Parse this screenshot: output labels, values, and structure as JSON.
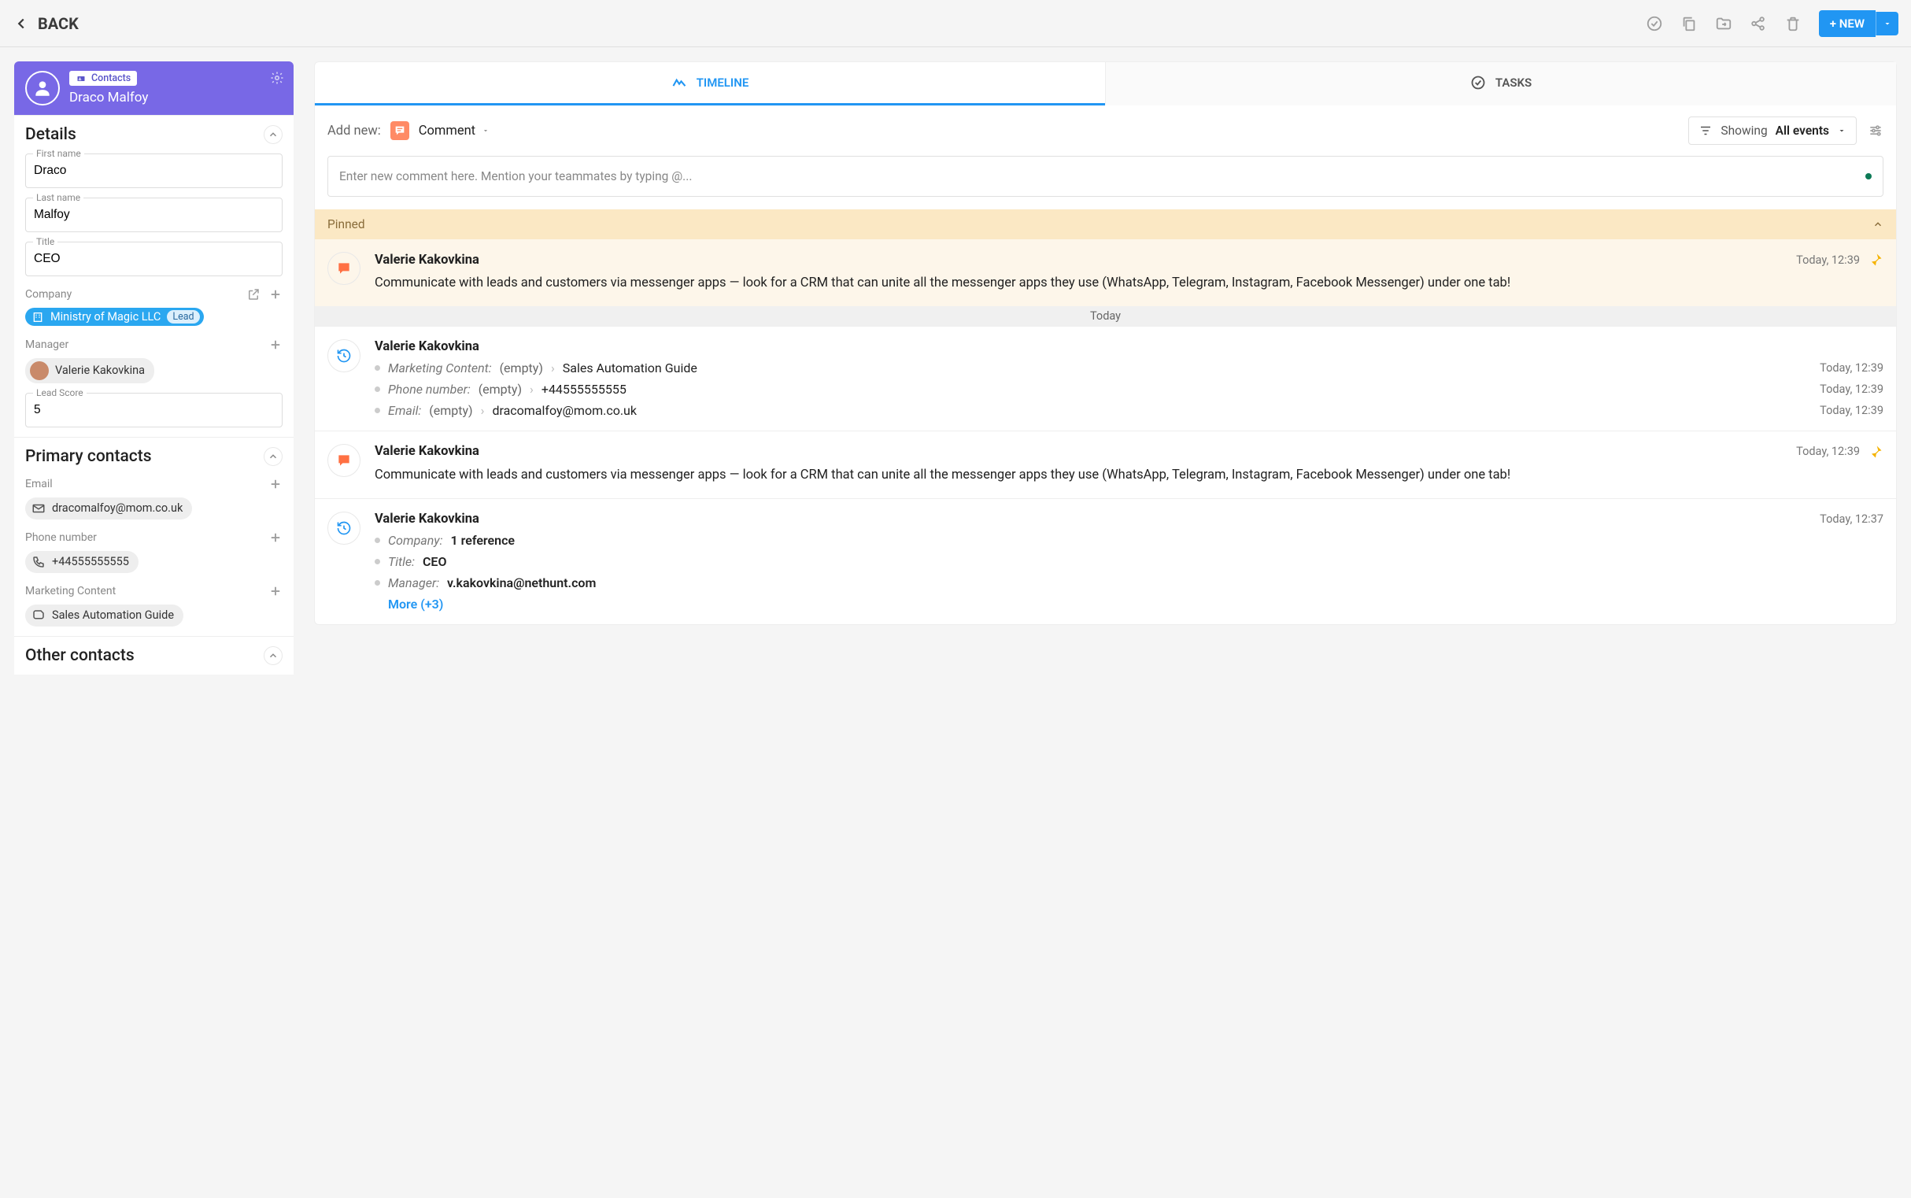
{
  "topbar": {
    "back": "BACK",
    "new_label": "+ NEW"
  },
  "contact": {
    "folder": "Contacts",
    "name": "Draco Malfoy"
  },
  "sections": {
    "details": "Details",
    "primary": "Primary contacts",
    "other": "Other contacts"
  },
  "details": {
    "first_name_label": "First name",
    "first_name": "Draco",
    "last_name_label": "Last name",
    "last_name": "Malfoy",
    "title_label": "Title",
    "title": "CEO",
    "company_label": "Company",
    "company_name": "Ministry of Magic LLC",
    "company_stage": "Lead",
    "manager_label": "Manager",
    "manager_name": "Valerie Kakovkina",
    "lead_score_label": "Lead Score",
    "lead_score": "5"
  },
  "primary": {
    "email_label": "Email",
    "email": "dracomalfoy@mom.co.uk",
    "phone_label": "Phone number",
    "phone": "+44555555555",
    "mc_label": "Marketing Content",
    "mc_value": "Sales Automation Guide"
  },
  "tabs": {
    "timeline": "TIMELINE",
    "tasks": "TASKS"
  },
  "addnew": {
    "label": "Add new:",
    "type": "Comment"
  },
  "filter": {
    "prefix": "Showing ",
    "value": "All events"
  },
  "comment_placeholder": "Enter new comment here. Mention your teammates by typing @...",
  "pinned_label": "Pinned",
  "today_label": "Today",
  "events": {
    "pinned": {
      "author": "Valerie Kakovkina",
      "time": "Today, 12:39",
      "text": "Communicate with leads and customers via messenger apps — look for a CRM that can unite all the messenger apps they use (WhatsApp, Telegram, Instagram, Facebook Messenger) under one tab!"
    },
    "e1": {
      "author": "Valerie Kakovkina",
      "changes": [
        {
          "field": "Marketing Content:",
          "from": "(empty)",
          "to": "Sales Automation Guide",
          "time": "Today, 12:39"
        },
        {
          "field": "Phone number:",
          "from": "(empty)",
          "to": "+44555555555",
          "time": "Today, 12:39"
        },
        {
          "field": "Email:",
          "from": "(empty)",
          "to": "dracomalfoy@mom.co.uk",
          "time": "Today, 12:39"
        }
      ]
    },
    "e2": {
      "author": "Valerie Kakovkina",
      "time": "Today, 12:39",
      "text": "Communicate with leads and customers via messenger apps — look for a CRM that can unite all the messenger apps they use (WhatsApp, Telegram, Instagram, Facebook Messenger) under one tab!"
    },
    "e3": {
      "author": "Valerie Kakovkina",
      "time": "Today, 12:37",
      "changes": [
        {
          "field": "Company:",
          "to": "1 reference"
        },
        {
          "field": "Title:",
          "to": "CEO"
        },
        {
          "field": "Manager:",
          "to": "v.kakovkina@nethunt.com"
        }
      ],
      "more": "More (+3)"
    }
  }
}
